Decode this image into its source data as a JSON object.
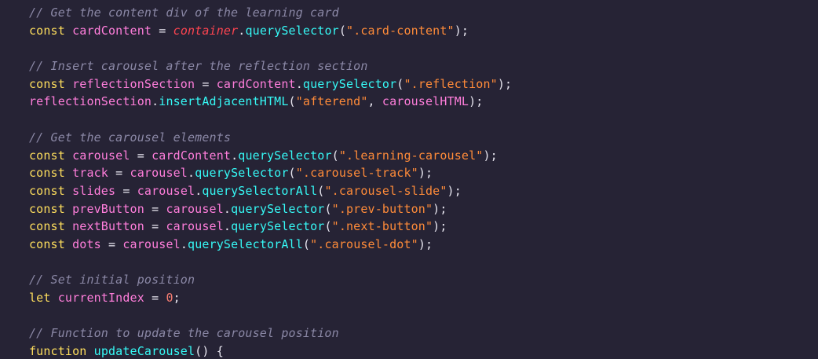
{
  "editor": {
    "lines": [
      [
        {
          "t": "// Get the content div of the learning card",
          "k": "comment"
        }
      ],
      [
        {
          "t": "const",
          "k": "keyword"
        },
        {
          "t": " cardContent ",
          "k": "var"
        },
        {
          "t": "= ",
          "k": "punct"
        },
        {
          "t": "container",
          "k": "container"
        },
        {
          "t": ".",
          "k": "punct"
        },
        {
          "t": "querySelector",
          "k": "method"
        },
        {
          "t": "(",
          "k": "punct"
        },
        {
          "t": "\".card-content\"",
          "k": "string"
        },
        {
          "t": ");",
          "k": "punct"
        }
      ],
      [],
      [
        {
          "t": "// Insert carousel after the reflection section",
          "k": "comment"
        }
      ],
      [
        {
          "t": "const",
          "k": "keyword"
        },
        {
          "t": " reflectionSection ",
          "k": "var"
        },
        {
          "t": "= ",
          "k": "punct"
        },
        {
          "t": "cardContent",
          "k": "var"
        },
        {
          "t": ".",
          "k": "punct"
        },
        {
          "t": "querySelector",
          "k": "method"
        },
        {
          "t": "(",
          "k": "punct"
        },
        {
          "t": "\".reflection\"",
          "k": "string"
        },
        {
          "t": ");",
          "k": "punct"
        }
      ],
      [
        {
          "t": "reflectionSection",
          "k": "var"
        },
        {
          "t": ".",
          "k": "punct"
        },
        {
          "t": "insertAdjacentHTML",
          "k": "method"
        },
        {
          "t": "(",
          "k": "punct"
        },
        {
          "t": "\"afterend\"",
          "k": "string"
        },
        {
          "t": ", ",
          "k": "punct"
        },
        {
          "t": "carouselHTML",
          "k": "var"
        },
        {
          "t": ");",
          "k": "punct"
        }
      ],
      [],
      [
        {
          "t": "// Get the carousel elements",
          "k": "comment"
        }
      ],
      [
        {
          "t": "const",
          "k": "keyword"
        },
        {
          "t": " carousel ",
          "k": "var"
        },
        {
          "t": "= ",
          "k": "punct"
        },
        {
          "t": "cardContent",
          "k": "var"
        },
        {
          "t": ".",
          "k": "punct"
        },
        {
          "t": "querySelector",
          "k": "method"
        },
        {
          "t": "(",
          "k": "punct"
        },
        {
          "t": "\".learning-carousel\"",
          "k": "string"
        },
        {
          "t": ");",
          "k": "punct"
        }
      ],
      [
        {
          "t": "const",
          "k": "keyword"
        },
        {
          "t": " track ",
          "k": "var"
        },
        {
          "t": "= ",
          "k": "punct"
        },
        {
          "t": "carousel",
          "k": "var"
        },
        {
          "t": ".",
          "k": "punct"
        },
        {
          "t": "querySelector",
          "k": "method"
        },
        {
          "t": "(",
          "k": "punct"
        },
        {
          "t": "\".carousel-track\"",
          "k": "string"
        },
        {
          "t": ");",
          "k": "punct"
        }
      ],
      [
        {
          "t": "const",
          "k": "keyword"
        },
        {
          "t": " slides ",
          "k": "var"
        },
        {
          "t": "= ",
          "k": "punct"
        },
        {
          "t": "carousel",
          "k": "var"
        },
        {
          "t": ".",
          "k": "punct"
        },
        {
          "t": "querySelectorAll",
          "k": "method"
        },
        {
          "t": "(",
          "k": "punct"
        },
        {
          "t": "\".carousel-slide\"",
          "k": "string"
        },
        {
          "t": ");",
          "k": "punct"
        }
      ],
      [
        {
          "t": "const",
          "k": "keyword"
        },
        {
          "t": " prevButton ",
          "k": "var"
        },
        {
          "t": "= ",
          "k": "punct"
        },
        {
          "t": "carousel",
          "k": "var"
        },
        {
          "t": ".",
          "k": "punct"
        },
        {
          "t": "querySelector",
          "k": "method"
        },
        {
          "t": "(",
          "k": "punct"
        },
        {
          "t": "\".prev-button\"",
          "k": "string"
        },
        {
          "t": ");",
          "k": "punct"
        }
      ],
      [
        {
          "t": "const",
          "k": "keyword"
        },
        {
          "t": " nextButton ",
          "k": "var"
        },
        {
          "t": "= ",
          "k": "punct"
        },
        {
          "t": "carousel",
          "k": "var"
        },
        {
          "t": ".",
          "k": "punct"
        },
        {
          "t": "querySelector",
          "k": "method"
        },
        {
          "t": "(",
          "k": "punct"
        },
        {
          "t": "\".next-button\"",
          "k": "string"
        },
        {
          "t": ");",
          "k": "punct"
        }
      ],
      [
        {
          "t": "const",
          "k": "keyword"
        },
        {
          "t": " dots ",
          "k": "var"
        },
        {
          "t": "= ",
          "k": "punct"
        },
        {
          "t": "carousel",
          "k": "var"
        },
        {
          "t": ".",
          "k": "punct"
        },
        {
          "t": "querySelectorAll",
          "k": "method"
        },
        {
          "t": "(",
          "k": "punct"
        },
        {
          "t": "\".carousel-dot\"",
          "k": "string"
        },
        {
          "t": ");",
          "k": "punct"
        }
      ],
      [],
      [
        {
          "t": "// Set initial position",
          "k": "comment"
        }
      ],
      [
        {
          "t": "let",
          "k": "keyword"
        },
        {
          "t": " currentIndex ",
          "k": "var"
        },
        {
          "t": "= ",
          "k": "punct"
        },
        {
          "t": "0",
          "k": "number"
        },
        {
          "t": ";",
          "k": "punct"
        }
      ],
      [],
      [
        {
          "t": "// Function to update the carousel position",
          "k": "comment"
        }
      ],
      [
        {
          "t": "function",
          "k": "keyword"
        },
        {
          "t": " ",
          "k": "punct"
        },
        {
          "t": "updateCarousel",
          "k": "fn"
        },
        {
          "t": "() {",
          "k": "punct"
        }
      ]
    ]
  },
  "colors": {
    "background": "#262335",
    "comment": "#8b88a6",
    "keyword": "#fede5d",
    "variable": "#ff7edb",
    "method": "#36f9f6",
    "string": "#ff8b39",
    "number": "#f97e72"
  }
}
